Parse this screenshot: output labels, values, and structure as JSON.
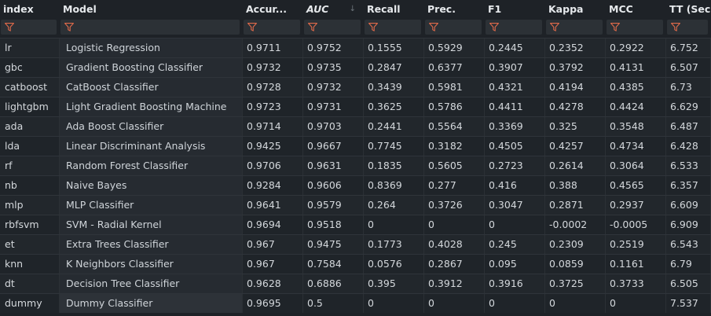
{
  "columns": [
    {
      "key": "index",
      "label": "index"
    },
    {
      "key": "model",
      "label": "Model"
    },
    {
      "key": "accuracy",
      "label": "Accur..."
    },
    {
      "key": "auc",
      "label": "AUC"
    },
    {
      "key": "recall",
      "label": "Recall"
    },
    {
      "key": "prec",
      "label": "Prec."
    },
    {
      "key": "f1",
      "label": "F1"
    },
    {
      "key": "kappa",
      "label": "Kappa"
    },
    {
      "key": "mcc",
      "label": "MCC"
    },
    {
      "key": "tt",
      "label": "TT (Sec)"
    }
  ],
  "sort": {
    "column": "auc",
    "direction": "descending",
    "icon": "sort-down-arrow-icon"
  },
  "rows": [
    [
      "lr",
      "Logistic Regression",
      "0.9711",
      "0.9752",
      "0.1555",
      "0.5929",
      "0.2445",
      "0.2352",
      "0.2922",
      "6.752"
    ],
    [
      "gbc",
      "Gradient Boosting Classifier",
      "0.9732",
      "0.9735",
      "0.2847",
      "0.6377",
      "0.3907",
      "0.3792",
      "0.4131",
      "6.507"
    ],
    [
      "catboost",
      "CatBoost Classifier",
      "0.9728",
      "0.9732",
      "0.3439",
      "0.5981",
      "0.4321",
      "0.4194",
      "0.4385",
      "6.73"
    ],
    [
      "lightgbm",
      "Light Gradient Boosting Machine",
      "0.9723",
      "0.9731",
      "0.3625",
      "0.5786",
      "0.4411",
      "0.4278",
      "0.4424",
      "6.629"
    ],
    [
      "ada",
      "Ada Boost Classifier",
      "0.9714",
      "0.9703",
      "0.2441",
      "0.5564",
      "0.3369",
      "0.325",
      "0.3548",
      "6.487"
    ],
    [
      "lda",
      "Linear Discriminant Analysis",
      "0.9425",
      "0.9667",
      "0.7745",
      "0.3182",
      "0.4505",
      "0.4257",
      "0.4734",
      "6.428"
    ],
    [
      "rf",
      "Random Forest Classifier",
      "0.9706",
      "0.9631",
      "0.1835",
      "0.5605",
      "0.2723",
      "0.2614",
      "0.3064",
      "6.533"
    ],
    [
      "nb",
      "Naive Bayes",
      "0.9284",
      "0.9606",
      "0.8369",
      "0.277",
      "0.416",
      "0.388",
      "0.4565",
      "6.357"
    ],
    [
      "mlp",
      "MLP Classifier",
      "0.9641",
      "0.9579",
      "0.264",
      "0.3726",
      "0.3047",
      "0.2871",
      "0.2937",
      "6.609"
    ],
    [
      "rbfsvm",
      "SVM - Radial Kernel",
      "0.9694",
      "0.9518",
      "0",
      "0",
      "0",
      "-0.0002",
      "-0.0005",
      "6.909"
    ],
    [
      "et",
      "Extra Trees Classifier",
      "0.967",
      "0.9475",
      "0.1773",
      "0.4028",
      "0.245",
      "0.2309",
      "0.2519",
      "6.543"
    ],
    [
      "knn",
      "K Neighbors Classifier",
      "0.967",
      "0.7584",
      "0.0576",
      "0.2867",
      "0.095",
      "0.0859",
      "0.1161",
      "6.79"
    ],
    [
      "dt",
      "Decision Tree Classifier",
      "0.9628",
      "0.6886",
      "0.395",
      "0.3912",
      "0.3916",
      "0.3725",
      "0.3733",
      "6.505"
    ],
    [
      "dummy",
      "Dummy Classifier",
      "0.9695",
      "0.5",
      "0",
      "0",
      "0",
      "0",
      "0",
      "7.537"
    ]
  ],
  "colors": {
    "background": "#1e2227",
    "filter_icon": "#e06a4a",
    "text": "#d4d8dc"
  }
}
